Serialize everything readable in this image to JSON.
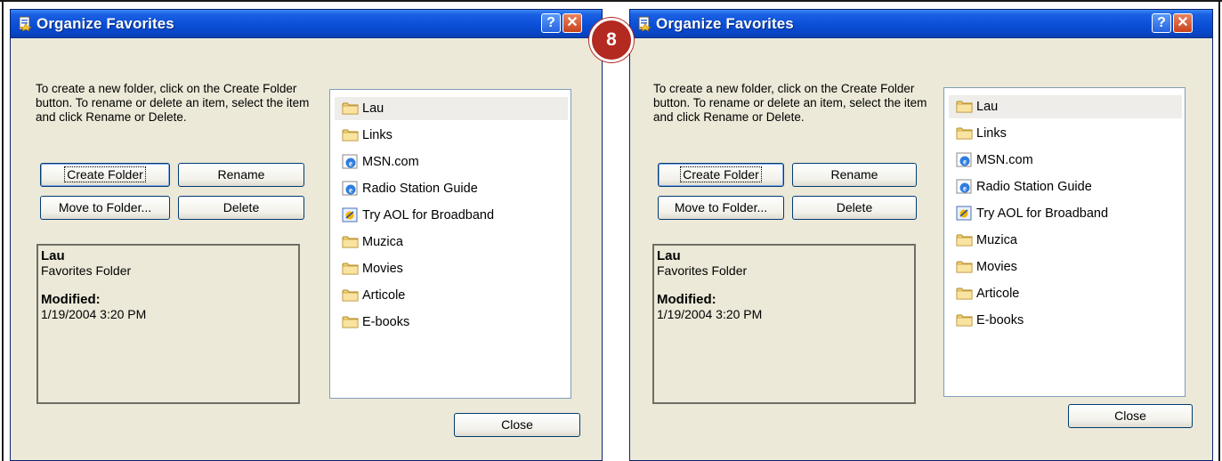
{
  "step_badge": "8",
  "dialogs": [
    {
      "title": "Organize Favorites",
      "help_glyph": "?",
      "close_glyph": "✕",
      "description": "To create a new folder, click on the Create Folder button. To rename or delete an item, select the item and click Rename or Delete.",
      "buttons": {
        "create_folder": "Create Folder",
        "rename": "Rename",
        "move_to_folder": "Move to Folder...",
        "delete": "Delete",
        "close": "Close"
      },
      "info": {
        "name": "Lau",
        "type": "Favorites Folder",
        "modified_label": "Modified:",
        "modified_value": "1/19/2004 3:20 PM"
      },
      "items": [
        {
          "label": "Lau",
          "icon": "folder-icon",
          "selected": true
        },
        {
          "label": "Links",
          "icon": "folder-icon"
        },
        {
          "label": "MSN.com",
          "icon": "ie-link-icon"
        },
        {
          "label": "Radio Station Guide",
          "icon": "ie-link-icon"
        },
        {
          "label": "Try AOL for Broadband",
          "icon": "aol-link-icon"
        },
        {
          "label": "Muzica",
          "icon": "folder-icon"
        },
        {
          "label": "Movies",
          "icon": "folder-icon"
        },
        {
          "label": "Articole",
          "icon": "folder-icon"
        },
        {
          "label": "E-books",
          "icon": "folder-icon"
        }
      ]
    },
    {
      "title": "Organize Favorites",
      "help_glyph": "?",
      "close_glyph": "✕",
      "description": "To create a new folder, click on the Create Folder button. To rename or delete an item, select the item and click Rename or Delete.",
      "buttons": {
        "create_folder": "Create Folder",
        "rename": "Rename",
        "move_to_folder": "Move to Folder...",
        "delete": "Delete",
        "close": "Close"
      },
      "info": {
        "name": "Lau",
        "type": "Favorites Folder",
        "modified_label": "Modified:",
        "modified_value": "1/19/2004 3:20 PM"
      },
      "items": [
        {
          "label": "Lau",
          "icon": "folder-icon",
          "selected": true
        },
        {
          "label": "Links",
          "icon": "folder-icon"
        },
        {
          "label": "MSN.com",
          "icon": "ie-link-icon"
        },
        {
          "label": "Radio Station Guide",
          "icon": "ie-link-icon"
        },
        {
          "label": "Try AOL for Broadband",
          "icon": "aol-link-icon"
        },
        {
          "label": "Muzica",
          "icon": "folder-icon"
        },
        {
          "label": "Movies",
          "icon": "folder-icon"
        },
        {
          "label": "Articole",
          "icon": "folder-icon"
        },
        {
          "label": "E-books",
          "icon": "folder-icon"
        }
      ]
    }
  ],
  "colors": {
    "titlebar": "#0a4fd6",
    "dialog_face": "#ece9d8",
    "badge": "#b22a20",
    "selection": "#eeedea"
  }
}
